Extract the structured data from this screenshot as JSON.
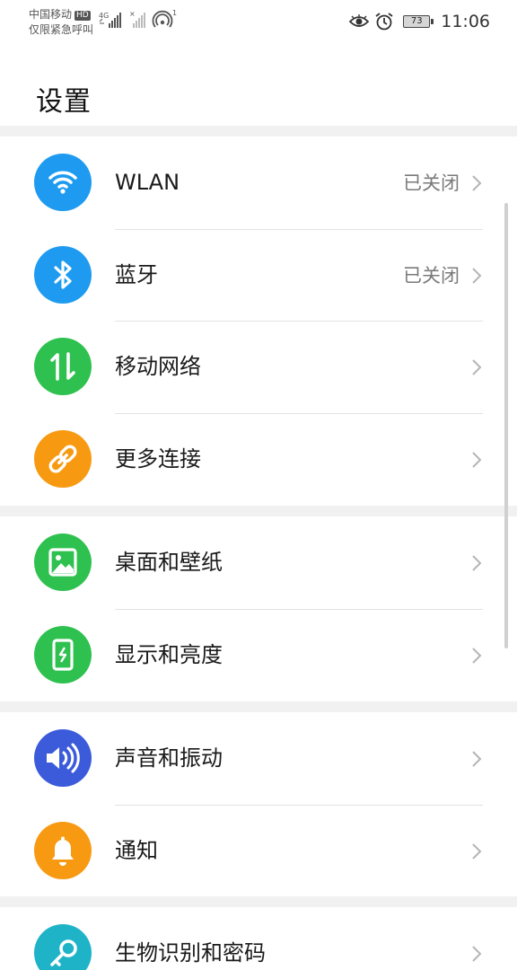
{
  "status_bar": {
    "carrier_line1": "中国移动",
    "hd_badge": "HD",
    "carrier_line2": "仅限紧急呼叫",
    "network_type": "4G",
    "hotspot_count": "1",
    "battery_level": "73",
    "time": "11:06",
    "icons": [
      "signal-icon",
      "no-signal-icon",
      "hotspot-icon",
      "eye-icon",
      "alarm-icon",
      "battery-icon"
    ]
  },
  "header": {
    "title": "设置"
  },
  "settings": {
    "items": [
      {
        "label": "WLAN",
        "value": "已关闭",
        "icon": "wifi-icon",
        "color": "#1E9BF0"
      },
      {
        "label": "蓝牙",
        "value": "已关闭",
        "icon": "bluetooth-icon",
        "color": "#1E9BF0"
      },
      {
        "label": "移动网络",
        "value": "",
        "icon": "mobile-network-icon",
        "color": "#2FC14F"
      },
      {
        "label": "更多连接",
        "value": "",
        "icon": "link-icon",
        "color": "#F79A12"
      },
      {
        "label": "桌面和壁纸",
        "value": "",
        "icon": "wallpaper-icon",
        "color": "#2FC14F"
      },
      {
        "label": "显示和亮度",
        "value": "",
        "icon": "display-icon",
        "color": "#2FC14F"
      },
      {
        "label": "声音和振动",
        "value": "",
        "icon": "sound-icon",
        "color": "#3B5BDB"
      },
      {
        "label": "通知",
        "value": "",
        "icon": "bell-icon",
        "color": "#F79A12"
      },
      {
        "label": "生物识别和密码",
        "value": "",
        "icon": "key-icon",
        "color": "#1FB3C8"
      }
    ]
  }
}
